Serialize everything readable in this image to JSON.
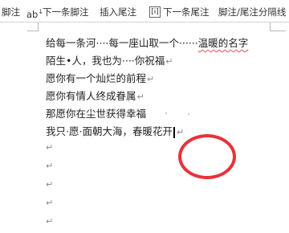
{
  "toolbar": {
    "item1_label": "脚注",
    "item2_icon_text": "ab",
    "item2_label": "下一条脚注",
    "item3_label": "插入尾注",
    "item4_label": "下一条尾注",
    "item5_label": "脚注/尾注分隔线"
  },
  "document": {
    "lines": [
      {
        "a": "给每一条河",
        "b": "····每一座山取一个······",
        "c": "温暖的名字"
      },
      {
        "a": "陌生•人，我也为····你祝福"
      },
      {
        "a": "愿你有一个灿烂的前程"
      },
      {
        "a": "愿你有情人终成眷属"
      },
      {
        "a": "那愿你在尘世获得幸福"
      },
      {
        "a": "我只·愿·面朝大海，春暖花",
        "b": "开"
      }
    ],
    "pilcrow": "↵"
  },
  "colors": {
    "annotation_circle": "#e8323a",
    "text": "#222222"
  }
}
